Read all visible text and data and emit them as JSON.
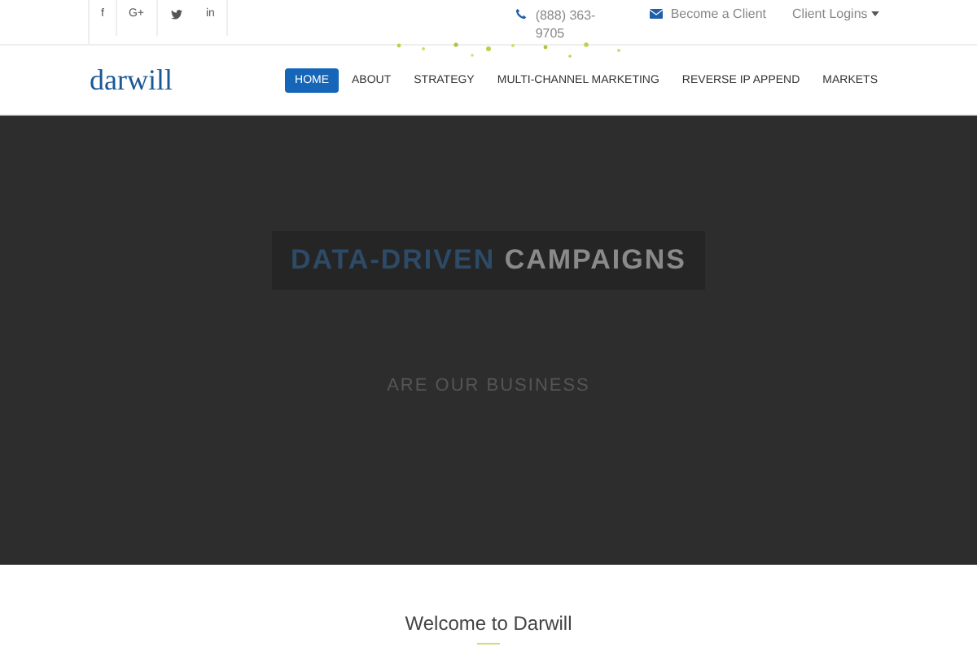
{
  "topbar": {
    "social": [
      {
        "kind": "text",
        "label": "f"
      },
      {
        "kind": "text",
        "label": "G+"
      },
      {
        "kind": "bird"
      },
      {
        "kind": "text",
        "label": "in"
      }
    ],
    "phone": "(888) 363-9705",
    "become_client": "Become a Client",
    "client_logins": "Client Logins"
  },
  "header": {
    "logo": "darwill",
    "nav": [
      {
        "label": "HOME",
        "selected": true
      },
      {
        "label": "ABOUT",
        "selected": false
      },
      {
        "label": "STRATEGY",
        "selected": false
      },
      {
        "label": "MULTI-CHANNEL MARKETING",
        "selected": false
      },
      {
        "label": "REVERSE IP APPEND",
        "selected": false
      },
      {
        "label": "MARKETS",
        "selected": false
      }
    ]
  },
  "hero": {
    "headline": [
      {
        "text": "DATA-DRIVEN",
        "highlight": true
      },
      {
        "text": "CAMPAIGNS",
        "highlight": false
      }
    ],
    "subtitle": "ARE OUR BUSINESS"
  },
  "welcome": {
    "title": "Welcome to Darwill"
  }
}
